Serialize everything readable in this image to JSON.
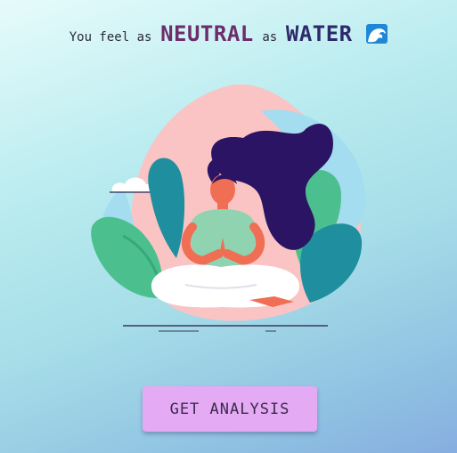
{
  "headline": {
    "prefix": "You feel as",
    "mood": "NEUTRAL",
    "connector": "as",
    "element": "WATER",
    "emoji_icon": "water-wave-icon"
  },
  "illustration": {
    "icon": "meditating-woman-illustration"
  },
  "actions": {
    "analysis_button": "GET ANALYSIS"
  },
  "colors": {
    "mood": "#6c2e6a",
    "element": "#2d2a6b",
    "button": "#e4aaf4"
  }
}
